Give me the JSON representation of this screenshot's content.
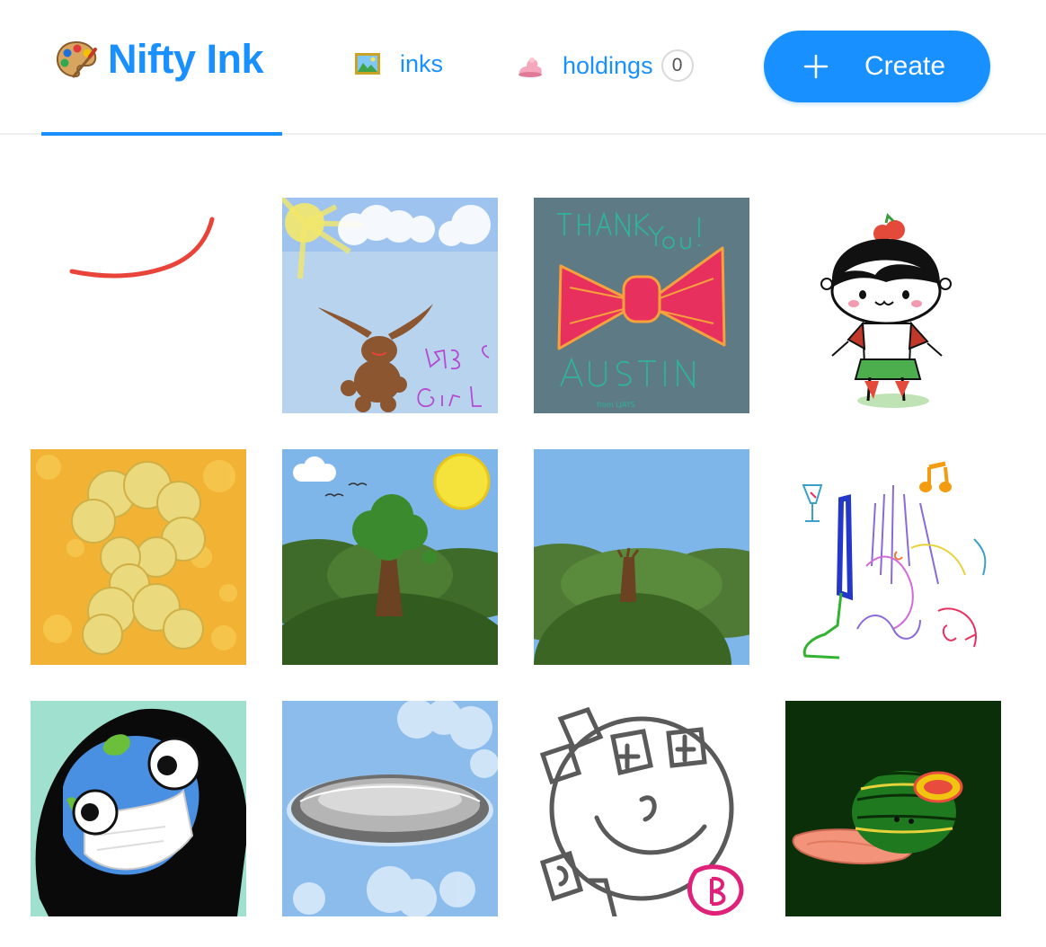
{
  "header": {
    "brand": "Nifty Ink",
    "brand_icon": "palette-icon",
    "nav": [
      {
        "label": "inks",
        "icon": "framed-picture-icon"
      },
      {
        "label": "holdings",
        "icon": "pink-ink-blob-icon",
        "count": "0"
      }
    ],
    "create_label": "Create",
    "create_icon": "plus-icon",
    "accent_color": "#1890ff"
  },
  "gallery": {
    "tiles": [
      {
        "subject": "red curved stroke"
      },
      {
        "subject": "brown bunny under sun",
        "caption": "BB's Girl"
      },
      {
        "subject": "pink bow tie",
        "text_top": "THANK YOU!",
        "text_bottom": "AUSTIN",
        "text_small": "from LJAYS"
      },
      {
        "subject": "kid with tomato hair"
      },
      {
        "subject": "yellow bokeh swirl"
      },
      {
        "subject": "tree on green hills with sun"
      },
      {
        "subject": "bare trunk on green hills"
      },
      {
        "subject": "colorful scribbles with music note"
      },
      {
        "subject": "earth wearing mask"
      },
      {
        "subject": "grey flying saucer in sky"
      },
      {
        "subject": "smiley face with money bags"
      },
      {
        "subject": "chupa chups candy turtle"
      }
    ]
  }
}
